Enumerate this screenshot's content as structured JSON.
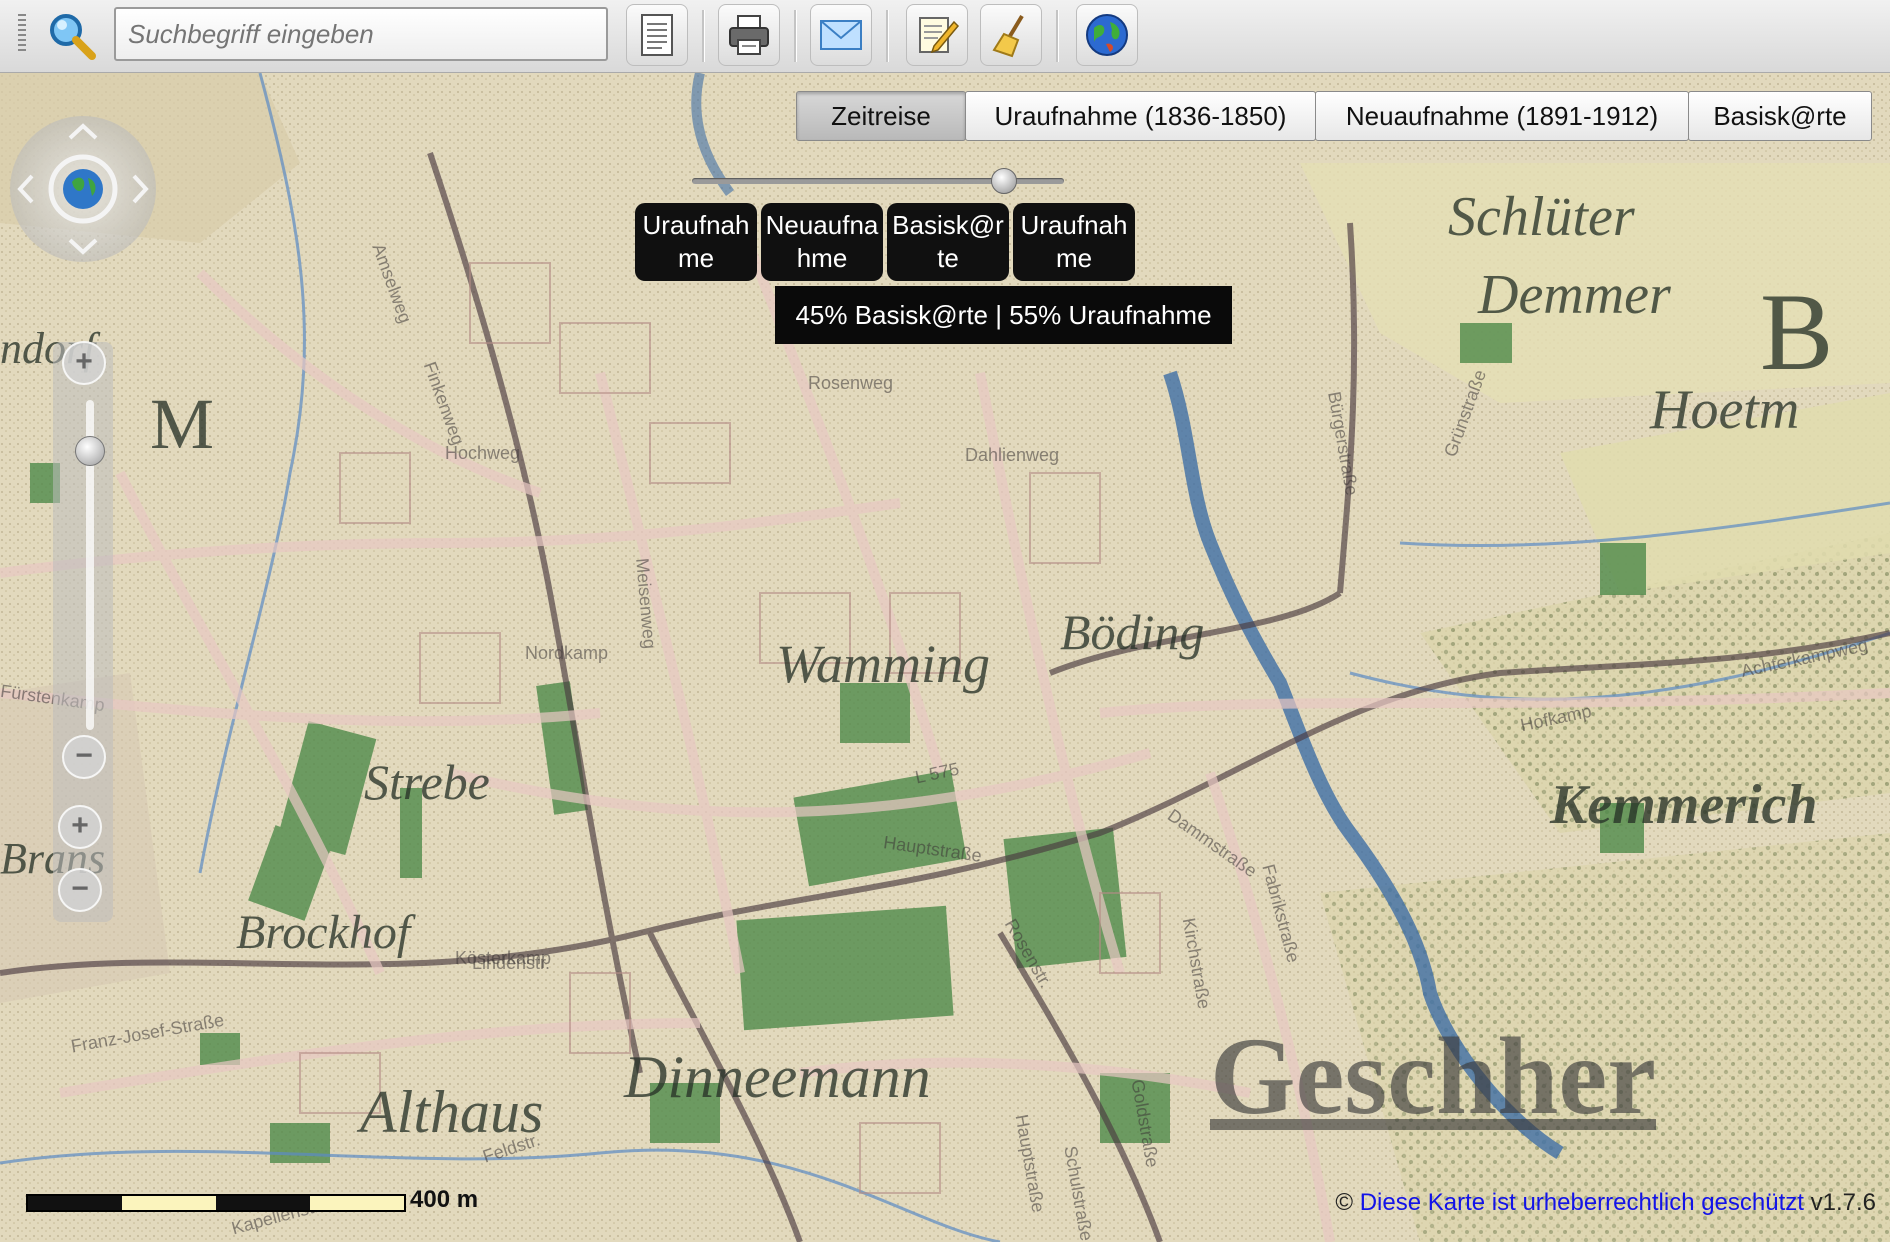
{
  "toolbar": {
    "search_placeholder": "Suchbegriff eingeben",
    "buttons": [
      "document-icon",
      "print-icon",
      "mail-icon",
      "edit-icon",
      "clear-icon",
      "globe-icon"
    ]
  },
  "layers": {
    "tabs": [
      {
        "label": "Zeitreise",
        "active": true
      },
      {
        "label": "Uraufnahme (1836-1850)",
        "active": false
      },
      {
        "label": "Neuaufnahme (1891-1912)",
        "active": false
      },
      {
        "label": "Basisk@rte",
        "active": false
      }
    ]
  },
  "time_slider": {
    "basiskarte_percent": 45,
    "uraufnahme_percent": 55,
    "era_buttons": [
      "Uraufnahme",
      "Neuaufnahme",
      "Basisk@rte",
      "Uraufnahme"
    ],
    "tooltip": "45% Basisk@rte | 55% Uraufnahme"
  },
  "map": {
    "place_labels": [
      "Schlüter",
      "Demmer",
      "B",
      "Hoetm",
      "Geschher",
      "Althaus",
      "Brockhof",
      "Strebe",
      "Brans",
      "ndorf",
      "Kemmerich",
      "Dinneemann",
      "Wamming",
      "Böding",
      "M"
    ],
    "street_labels": [
      "Rosenweg",
      "Dahlienweg",
      "Nordkamp",
      "Hauptstraße",
      "Fabrikstraße",
      "Feldstr.",
      "Lindenstr.",
      "Franz-Josef-Straße",
      "Rosenstr.",
      "Kirchstraße",
      "L 575",
      "Meisenweg",
      "Finkenweg",
      "Amselweg",
      "Hochweg",
      "Kösterkamp",
      "Fürstenkamp",
      "Grünstraße",
      "Bürgerstraße",
      "Hofkamp",
      "Goldstraße",
      "Hauptstraße",
      "Kapellenstraße",
      "Schulstraße",
      "Dammstraße",
      "Achterkampweg"
    ]
  },
  "scale": {
    "label": "400 m"
  },
  "footer": {
    "copyright_symbol": "©",
    "copyright_link": "Diese Karte ist urheberrechtlich geschützt",
    "version": "v1.7.6"
  }
}
